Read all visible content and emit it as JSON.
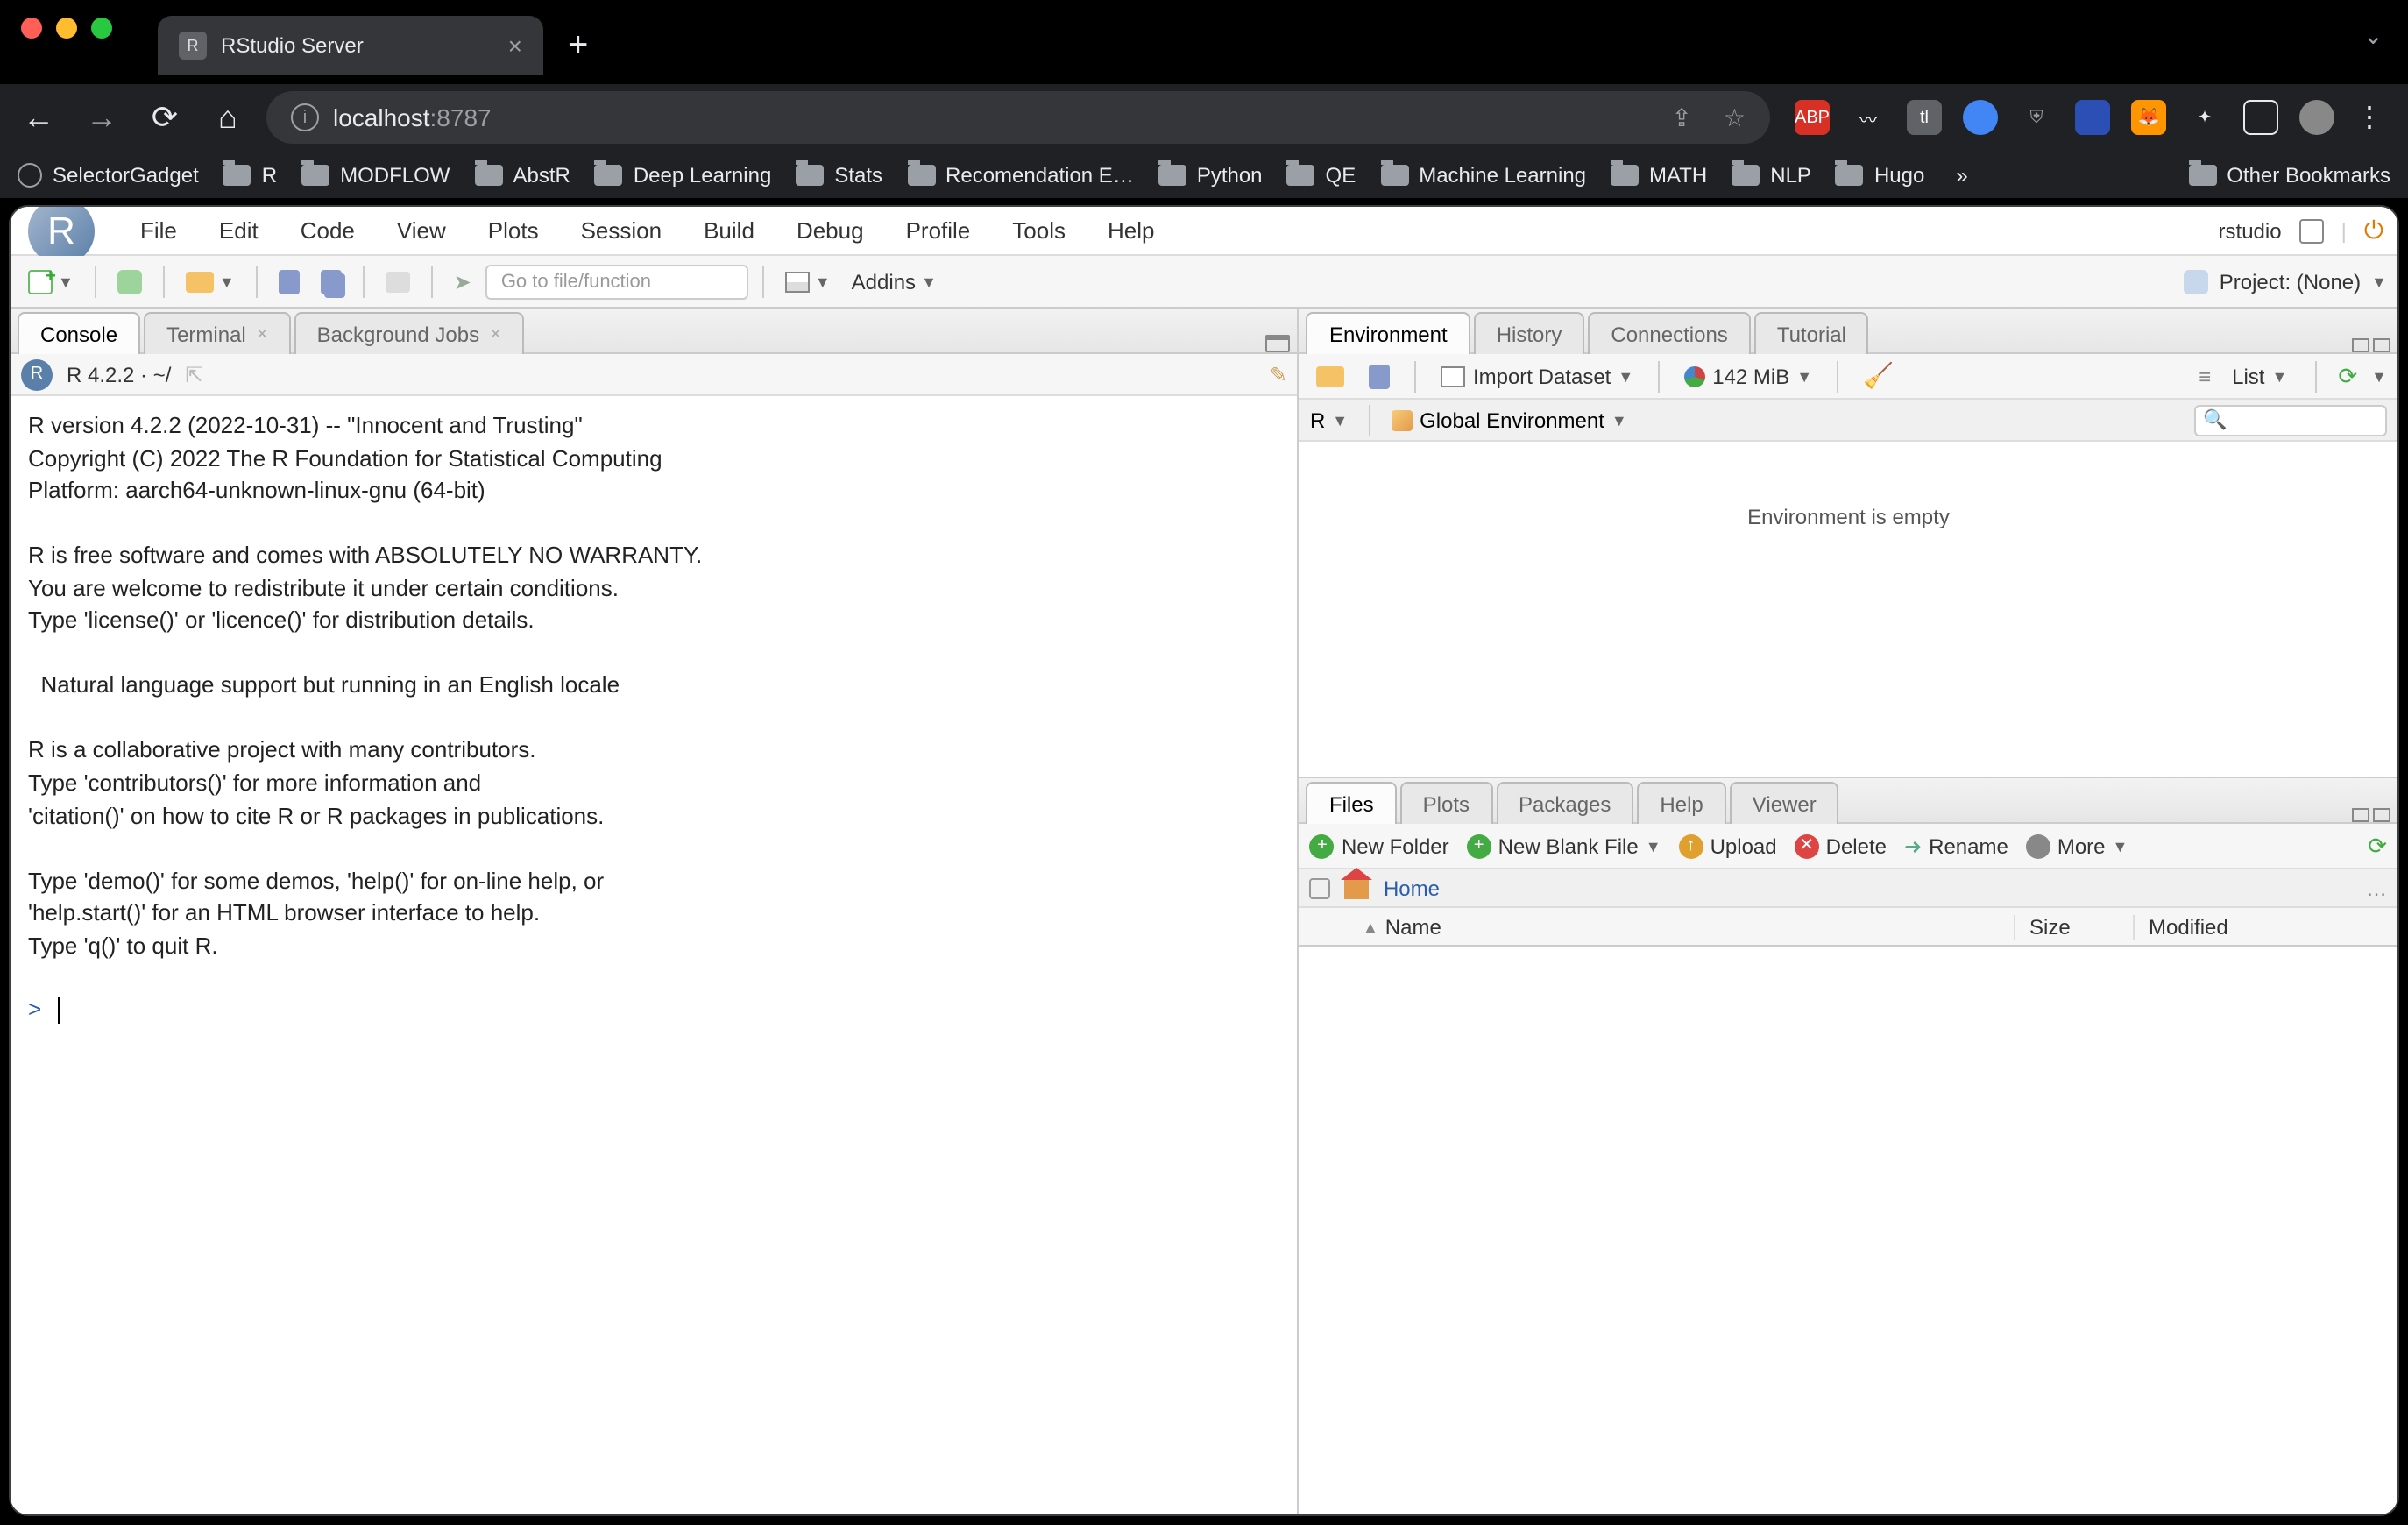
{
  "browser": {
    "tab_title": "RStudio Server",
    "url_host": "localhost",
    "url_port": ":8787",
    "bookmarks": [
      "SelectorGadget",
      "R",
      "MODFLOW",
      "AbstR",
      "Deep Learning",
      "Stats",
      "Recomendation E…",
      "Python",
      "QE",
      "Machine Learning",
      "MATH",
      "NLP",
      "Hugo"
    ],
    "bookmarks_more": "»",
    "other_bookmarks": "Other Bookmarks"
  },
  "rstudio": {
    "menus": [
      "File",
      "Edit",
      "Code",
      "View",
      "Plots",
      "Session",
      "Build",
      "Debug",
      "Profile",
      "Tools",
      "Help"
    ],
    "user": "rstudio",
    "goto_placeholder": "Go to file/function",
    "addins": "Addins",
    "project": "Project: (None)",
    "left": {
      "tabs": {
        "console": "Console",
        "terminal": "Terminal",
        "bgjobs": "Background Jobs"
      },
      "header": "R 4.2.2 · ~/",
      "console_text": "R version 4.2.2 (2022-10-31) -- \"Innocent and Trusting\"\nCopyright (C) 2022 The R Foundation for Statistical Computing\nPlatform: aarch64-unknown-linux-gnu (64-bit)\n\nR is free software and comes with ABSOLUTELY NO WARRANTY.\nYou are welcome to redistribute it under certain conditions.\nType 'license()' or 'licence()' for distribution details.\n\n  Natural language support but running in an English locale\n\nR is a collaborative project with many contributors.\nType 'contributors()' for more information and\n'citation()' on how to cite R or R packages in publications.\n\nType 'demo()' for some demos, 'help()' for on-line help, or\n'help.start()' for an HTML browser interface to help.\nType 'q()' to quit R.\n",
      "prompt": ">"
    },
    "env": {
      "tabs": {
        "env": "Environment",
        "history": "History",
        "conn": "Connections",
        "tut": "Tutorial"
      },
      "import": "Import Dataset",
      "mem": "142 MiB",
      "list": "List",
      "lang": "R",
      "scope": "Global Environment",
      "empty": "Environment is empty"
    },
    "files": {
      "tabs": {
        "files": "Files",
        "plots": "Plots",
        "pkg": "Packages",
        "help": "Help",
        "viewer": "Viewer"
      },
      "newfolder": "New Folder",
      "newblank": "New Blank File",
      "upload": "Upload",
      "delete": "Delete",
      "rename": "Rename",
      "more": "More",
      "home": "Home",
      "columns": {
        "name": "Name",
        "size": "Size",
        "modified": "Modified"
      }
    }
  }
}
